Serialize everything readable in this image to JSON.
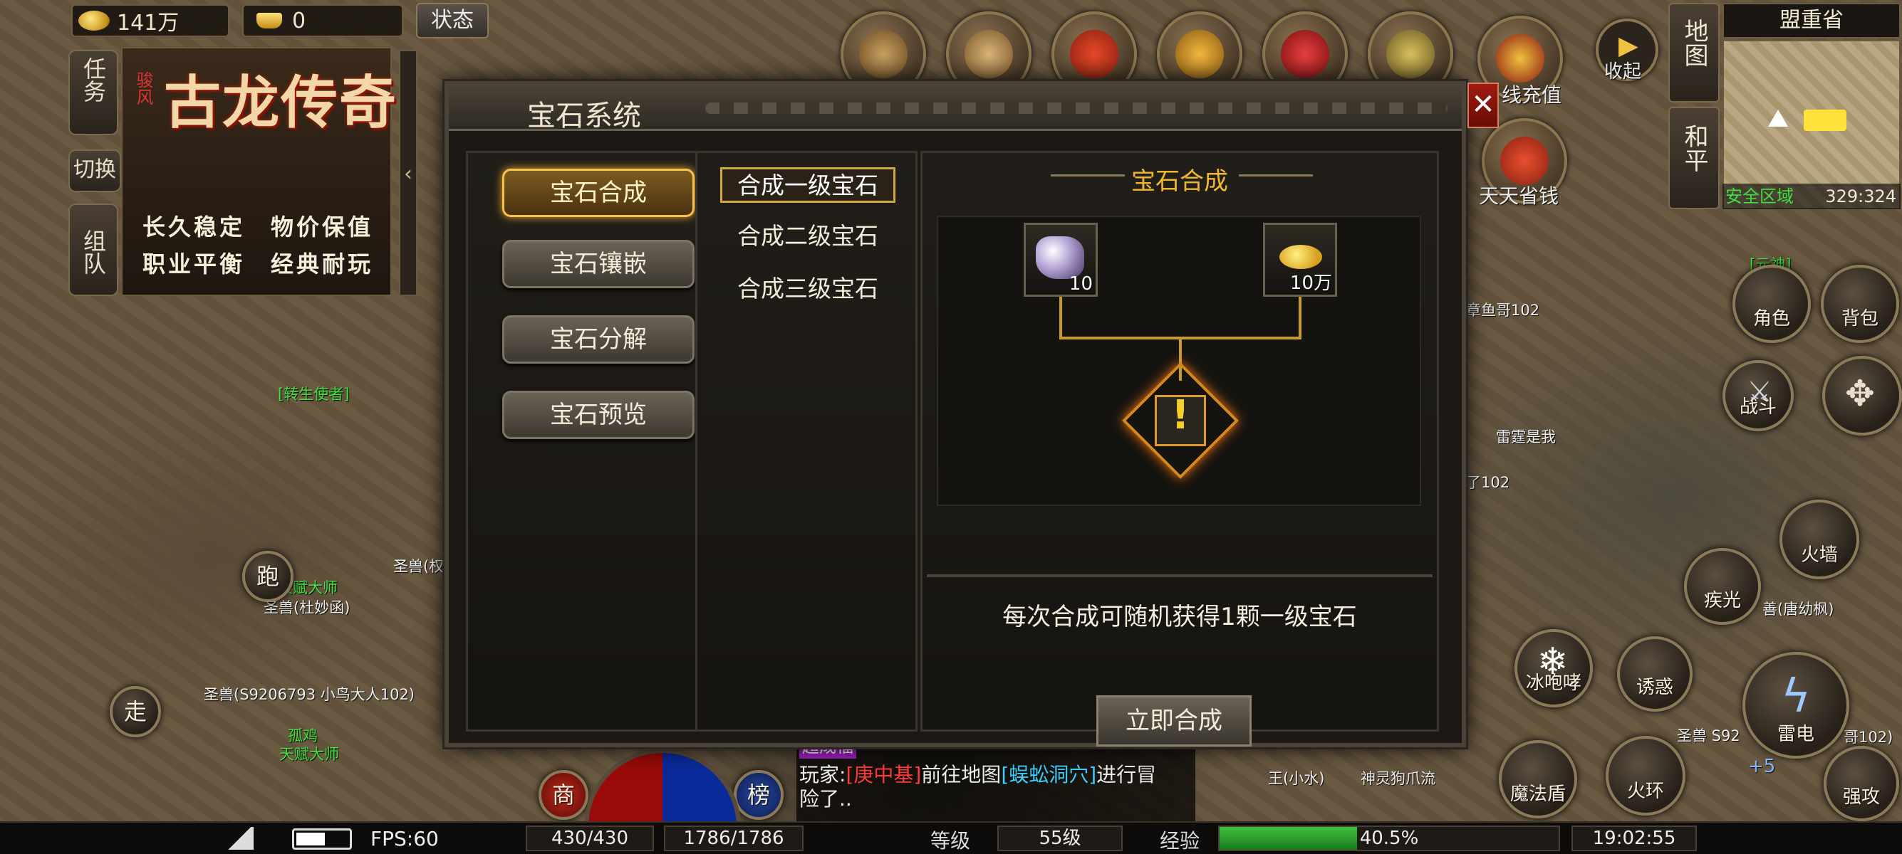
{
  "hud": {
    "gold": "141万",
    "ingot": "0",
    "status_label": "状态"
  },
  "left_panel": {
    "tab_task": "任务",
    "tab_switch": "切换",
    "tab_team": "组队",
    "logo_text": "古龙传奇",
    "logo_small": "骏风",
    "slogan_line1": "长久稳定　物价保值",
    "slogan_line2": "职业平衡　经典耐玩"
  },
  "top_icons": {
    "recharge": "线充值",
    "save_money": "天天省钱",
    "collapse": "收起"
  },
  "map": {
    "region": "盟重省",
    "btn_map": "地图",
    "btn_peace": "和平",
    "safe_zone": "安全区域",
    "coords": "329:324"
  },
  "dialog": {
    "title": "宝石系统",
    "close": "✕",
    "menu": [
      {
        "label": "宝石合成",
        "active": true
      },
      {
        "label": "宝石镶嵌",
        "active": false
      },
      {
        "label": "宝石分解",
        "active": false
      },
      {
        "label": "宝石预览",
        "active": false
      }
    ],
    "submenu": [
      {
        "label": "合成一级宝石",
        "active": true
      },
      {
        "label": "合成二级宝石",
        "active": false
      },
      {
        "label": "合成三级宝石",
        "active": false
      }
    ],
    "section_title": "宝石合成",
    "input_gem_count": "10",
    "input_gold_count": "10万",
    "result_symbol": "!",
    "description": "每次合成可随机获得1颗一级宝石",
    "combine_button": "立即合成"
  },
  "right_buttons": {
    "character": "角色",
    "bag": "背包",
    "battle": "战斗",
    "fire_wall": "火墙",
    "ice_roar": "冰咆哮",
    "lure": "诱惑",
    "thunder": "雷电",
    "magic_shield": "魔法盾",
    "fire_ring": "火环",
    "attack": "强攻",
    "flash": "疾光",
    "plus": "+5"
  },
  "left_controls": {
    "run": "跑",
    "walk": "走",
    "shop": "商",
    "rank": "榜"
  },
  "chat": {
    "tag": "超成福",
    "prefix": "玩家:",
    "player": "[庚中基]",
    "middle": "前往地图",
    "place": "[蜈蚣洞穴]",
    "suffix": "进行冒",
    "line2": "险了.."
  },
  "names": {
    "n1": "[转生使者]",
    "n2": "章鱼哥102",
    "n3": "雷霆是我",
    "n4": "了102",
    "n5": "圣兽(S9206793 小鸟大人102)",
    "n6": "孤鸡",
    "n7": "天赋大师",
    "n8": "圣兽(杜妙函)",
    "n9": "圣兽(权",
    "n10": "善(唐幼枫)",
    "n11": "圣兽 S92",
    "n12": "哥102)",
    "n13": "神灵狗爪流",
    "n14": "王(小水)",
    "n15": "[元神]",
    "n16": "天赋大师"
  },
  "bottom_bar": {
    "fps": "FPS:60",
    "hp": "430/430",
    "mp": "1786/1786",
    "level_label": "等级",
    "level": "55级",
    "exp_label": "经验",
    "exp_value": "40.5%",
    "exp_fraction": 0.405,
    "time": "19:02:55"
  }
}
